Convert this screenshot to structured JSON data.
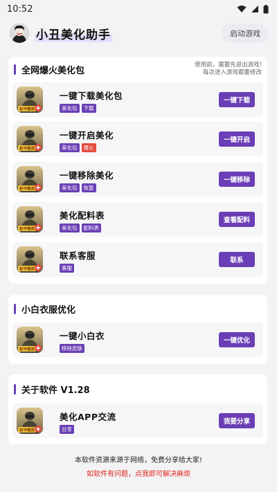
{
  "status_bar": {
    "time": "10:52"
  },
  "header": {
    "title": "小丑美化助手",
    "launch_button": "启动游戏"
  },
  "sections": [
    {
      "title": "全网爆火美化包",
      "note": "使用前，需要先退出游戏!\n每次进入游戏都要修改",
      "items": [
        {
          "title": "一键下载美化包",
          "tags": [
            "美化包",
            "下载"
          ],
          "button": "一键下载"
        },
        {
          "title": "一键开启美化",
          "tags": [
            "美化包",
            "爆火"
          ],
          "button": "一键开启"
        },
        {
          "title": "一键移除美化",
          "tags": [
            "美化包",
            "恢复"
          ],
          "button": "一键移除"
        },
        {
          "title": "美化配料表",
          "tags": [
            "美化包",
            "配料表"
          ],
          "button": "查看配料"
        },
        {
          "title": "联系客服",
          "tags": [
            "客服"
          ],
          "button": "联系"
        }
      ]
    },
    {
      "title": "小白衣服优化",
      "items": [
        {
          "title": "一键小白衣",
          "tags": [
            "移除皮肤"
          ],
          "button": "一键优化"
        }
      ]
    },
    {
      "title": "关于软件 V1.28",
      "items": [
        {
          "title": "美化APP交流",
          "tags": [
            "分享"
          ],
          "button": "我要分享"
        }
      ]
    }
  ],
  "icon_badge": "和平精英",
  "footer": {
    "line1": "本软件资源来源于网络，免费分享给大家!",
    "line2": "如软件有问题，点我即可解决麻烦"
  },
  "colors": {
    "accent": "#6a3fb5",
    "tag_red": "#e24a3c",
    "footer_red": "#e0251b",
    "background": "#f3f3f5"
  }
}
